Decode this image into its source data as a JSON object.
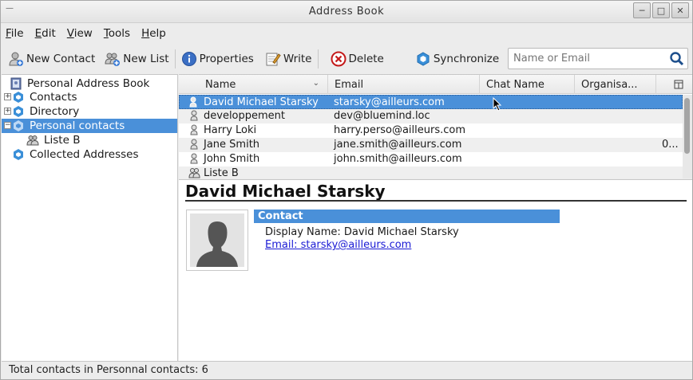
{
  "window": {
    "title": "Address Book"
  },
  "menubar": [
    {
      "pre": "",
      "ul": "F",
      "post": "ile"
    },
    {
      "pre": "",
      "ul": "E",
      "post": "dit"
    },
    {
      "pre": "",
      "ul": "V",
      "post": "iew"
    },
    {
      "pre": "",
      "ul": "T",
      "post": "ools"
    },
    {
      "pre": "",
      "ul": "H",
      "post": "elp"
    }
  ],
  "toolbar": {
    "new_contact": "New Contact",
    "new_list": "New List",
    "properties": "Properties",
    "write": "Write",
    "delete": "Delete",
    "synchronize": "Synchronize",
    "search_placeholder": "Name or Email"
  },
  "sidebar": {
    "items": [
      {
        "label": "Personal Address Book",
        "icon": "address-book-icon"
      },
      {
        "label": "Contacts",
        "icon": "bluemind-book-icon"
      },
      {
        "label": "Directory",
        "icon": "bluemind-book-icon"
      },
      {
        "label": "Personal contacts",
        "icon": "bluemind-book-icon",
        "selected": true
      },
      {
        "label": "Liste B",
        "icon": "mailing-list-icon"
      },
      {
        "label": "Collected Addresses",
        "icon": "bluemind-book-icon"
      }
    ]
  },
  "results": {
    "columns": [
      "Name",
      "Email",
      "Chat Name",
      "Organisa..."
    ],
    "rows": [
      {
        "name": "David Michael Starsky",
        "email": "starsky@ailleurs.com",
        "chat": "",
        "org": "",
        "type": "contact",
        "selected": true
      },
      {
        "name": "developpement",
        "email": "dev@bluemind.loc",
        "chat": "",
        "org": "",
        "type": "contact"
      },
      {
        "name": "Harry Loki",
        "email": "harry.perso@ailleurs.com",
        "chat": "",
        "org": "",
        "type": "contact"
      },
      {
        "name": "Jane Smith",
        "email": "jane.smith@ailleurs.com",
        "chat": "",
        "org": "0...",
        "type": "contact"
      },
      {
        "name": "John Smith",
        "email": "john.smith@ailleurs.com",
        "chat": "",
        "org": "",
        "type": "contact"
      },
      {
        "name": "Liste B",
        "email": "",
        "chat": "",
        "org": "",
        "type": "list"
      }
    ]
  },
  "contact": {
    "display_name_heading": "David Michael Starsky",
    "section": "Contact",
    "display_name_field": "Display Name: David Michael Starsky",
    "email_field": "Email: starsky@ailleurs.com"
  },
  "status": {
    "text": "Total contacts in Personnal contacts: 6"
  },
  "colors": {
    "selection": "#4a90d9",
    "link": "#1a1ad4"
  }
}
